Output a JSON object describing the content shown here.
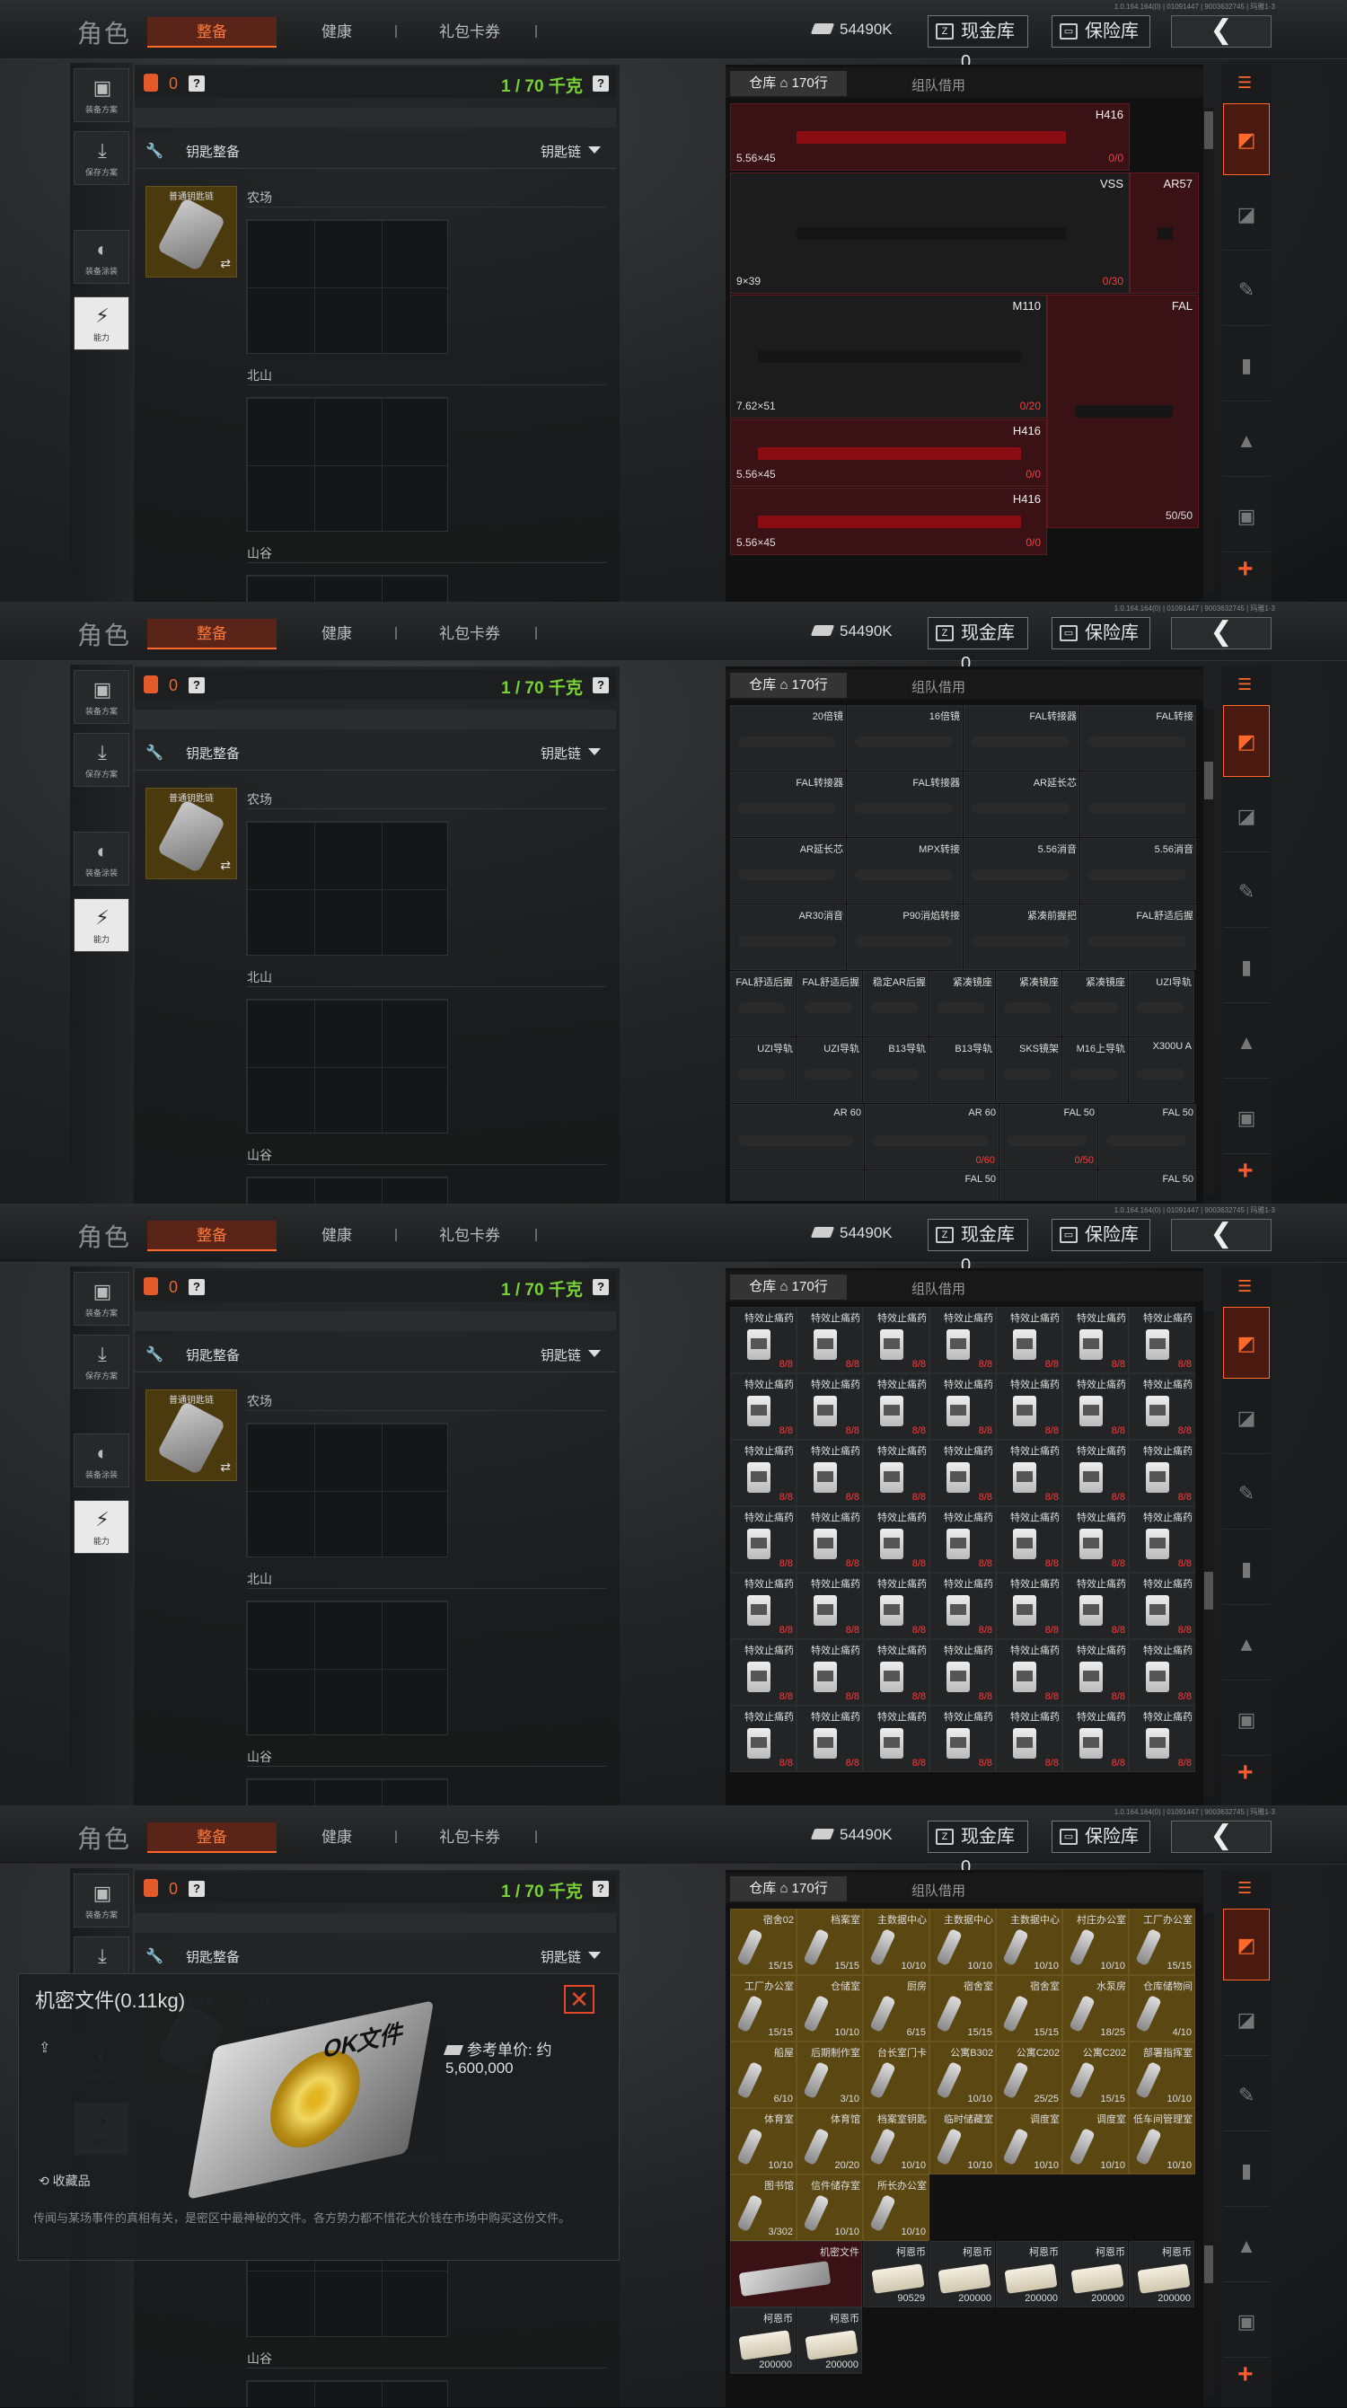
{
  "app": {
    "title": "角色",
    "tabs": [
      {
        "label": "整备",
        "active": true
      },
      {
        "label": "健康",
        "active": false
      },
      {
        "label": "礼包卡券",
        "active": false
      }
    ],
    "money": "54490K",
    "cash_vault": "现金库 0",
    "safe_vault": "保险库",
    "version": "1.0.164.164(0) | 01091447 | 9003632745 | 玛雅1-3"
  },
  "left_buttons": [
    {
      "label": "装备方案",
      "icon": "vest-icon"
    },
    {
      "label": "保存方案",
      "icon": "download-icon"
    },
    {
      "label": "装备涂装",
      "icon": "helmet-icon"
    },
    {
      "label": "能力",
      "icon": "ability-icon"
    }
  ],
  "loadout": {
    "weight": "0",
    "capacity": "1 / 70 千克",
    "keys_title": "钥匙整备",
    "keychain_dropdown": "钥匙链",
    "key_card_label": "普通钥匙链",
    "slots": [
      "农场",
      "北山",
      "山谷"
    ]
  },
  "storage": {
    "tab_warehouse": "仓库 ⌂ 170行",
    "tab_team": "组队借用"
  },
  "weapons": [
    {
      "name": "H416",
      "caliber": "5.56×45",
      "ammo": "0/0"
    },
    {
      "name": "VSS",
      "caliber": "9×39",
      "ammo": "0/30"
    },
    {
      "name": "AR57",
      "caliber": "",
      "ammo": ""
    },
    {
      "name": "M110",
      "caliber": "7.62×51",
      "ammo": "0/20"
    },
    {
      "name": "FAL",
      "caliber": "",
      "ammo": "50/50"
    },
    {
      "name": "H416",
      "caliber": "5.56×45",
      "ammo": "0/0"
    },
    {
      "name": "H416",
      "caliber": "5.56×45",
      "ammo": "0/0"
    }
  ],
  "attachments": [
    "20倍镜",
    "16倍镜",
    "FAL转接器",
    "FAL转接",
    "FAL转接器",
    "FAL转接器",
    "AR延长芯",
    "",
    "AR延长芯",
    "MPX转接",
    "5.56消音",
    "5.56消音",
    "AR30消音",
    "P90消焰转接",
    "紧凑前握把",
    "FAL舒适后握",
    "FAL舒适后握",
    "FAL舒适后握",
    "稳定AR后握",
    "紧凑镜座",
    "紧凑镜座",
    "紧凑镜座",
    "UZI导轨",
    "UZI导轨",
    "UZI导轨",
    "B13导轨",
    "B13导轨",
    "SKS镜架",
    "M16上导轨",
    "X300U A",
    "AR 60",
    "AR 60",
    "FAL 50",
    "FAL 50",
    "",
    "FAL 50",
    "",
    "FAL 50"
  ],
  "attachment_counts": [
    "0/60",
    "0/50"
  ],
  "medicine": {
    "name": "特效止痛药",
    "count": "8/8"
  },
  "keys": [
    "宿舍02",
    "档案室",
    "主数据中心",
    "主数据中心",
    "主数据中心",
    "村庄办公室",
    "工厂办公室",
    "工厂办公室",
    "仓储室",
    "厨房",
    "宿舍室",
    "宿舍室",
    "水泵房",
    "仓库储物间",
    "船屋",
    "后期制作室",
    "台长室门卡",
    "公寓B302",
    "公寓C202",
    "公寓C202",
    "部署指挥室",
    "体育室",
    "体育馆",
    "档案室钥匙",
    "临时储藏室",
    "调度室",
    "调度室",
    "低车间管理室",
    "图书馆",
    "信件储存室",
    "所长办公室"
  ],
  "key_counts": [
    "15/15",
    "15/15",
    "10/10",
    "10/10",
    "10/10",
    "10/10",
    "15/15",
    "15/15",
    "10/10",
    "6/15",
    "15/15",
    "15/15",
    "18/25",
    "4/10",
    "6/10",
    "3/10",
    "",
    "10/10",
    "25/25",
    "15/15",
    "10/10",
    "10/10",
    "20/20",
    "10/10",
    "10/10",
    "10/10",
    "10/10",
    "10/10",
    "3/302",
    "10/10",
    "10/10"
  ],
  "bottom_items": [
    {
      "name": "机密文件",
      "count": ""
    },
    {
      "name": "柯恩币",
      "count": "90529"
    },
    {
      "name": "柯恩币",
      "count": "200000"
    },
    {
      "name": "柯恩币",
      "count": "200000"
    },
    {
      "name": "柯恩币",
      "count": "200000"
    },
    {
      "name": "柯恩币",
      "count": "200000"
    },
    {
      "name": "柯恩币",
      "count": "200000"
    },
    {
      "name": "柯恩币",
      "count": "200000"
    }
  ],
  "popup": {
    "title": "机密文件(0.11kg)",
    "price": "参考单价: 约5,600,000",
    "disk_text": "OK文件 ",
    "favorite": "收藏品",
    "description": "传闻与某场事件的真相有关，是密区中最神秘的文件。各方势力都不惜花大价钱在市场中购买这份文件。"
  },
  "colors": {
    "accent": "#ff6a2a",
    "capacity_green": "#78d236",
    "weapon_bg": "#3a1216",
    "key_bg": "#5a4712"
  }
}
